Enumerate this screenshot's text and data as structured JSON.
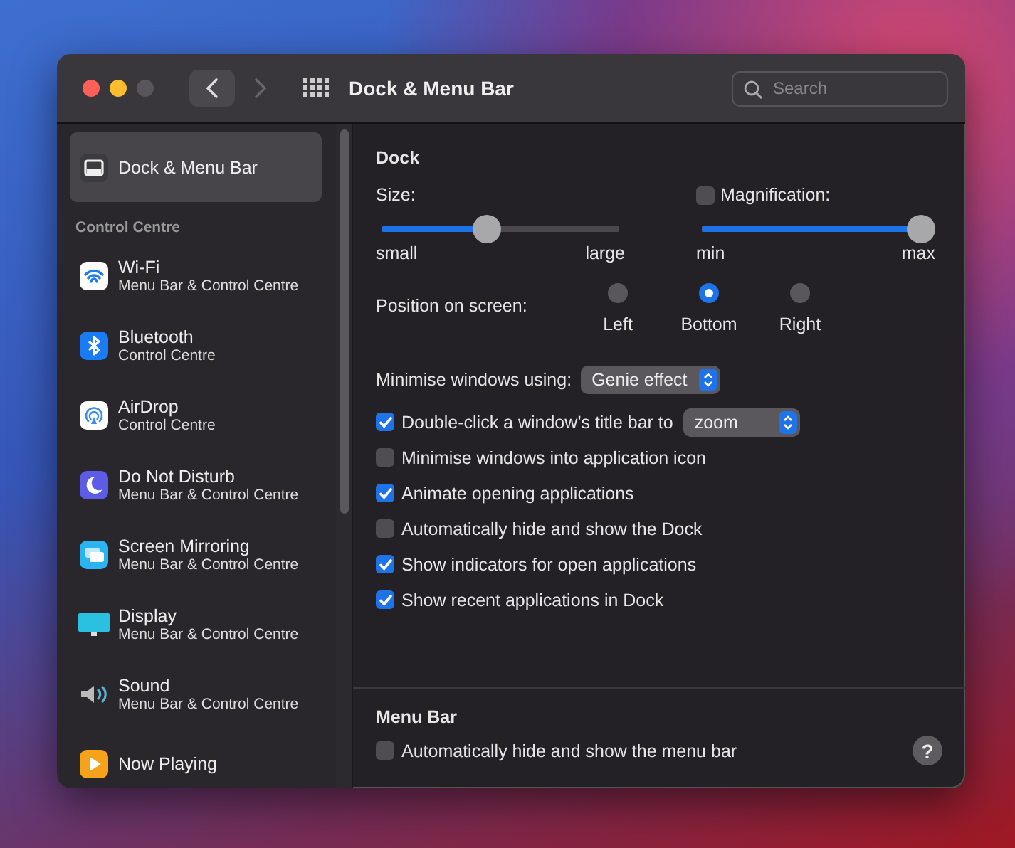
{
  "window": {
    "title": "Dock & Menu Bar"
  },
  "toolbar": {
    "search": {
      "placeholder": "Search"
    }
  },
  "sidebar": {
    "pinned": [
      {
        "label": "Dock & Menu Bar",
        "kind": "dock",
        "selected": true
      }
    ],
    "section": {
      "title": "Control Centre",
      "items": [
        {
          "label": "Wi-Fi",
          "subtitle": "Menu Bar & Control Centre",
          "kind": "wifi",
          "selected": false
        },
        {
          "label": "Bluetooth",
          "subtitle": "Control Centre",
          "kind": "bluetooth",
          "selected": false
        },
        {
          "label": "AirDrop",
          "subtitle": "Control Centre",
          "kind": "airdrop",
          "selected": false
        },
        {
          "label": "Do Not Disturb",
          "subtitle": "Menu Bar & Control Centre",
          "kind": "moon",
          "selected": false
        },
        {
          "label": "Screen Mirroring",
          "subtitle": "Menu Bar & Control Centre",
          "kind": "mirroring",
          "selected": false
        },
        {
          "label": "Display",
          "subtitle": "Menu Bar & Control Centre",
          "kind": "display",
          "selected": false
        },
        {
          "label": "Sound",
          "subtitle": "Menu Bar & Control Centre",
          "kind": "sound",
          "selected": false
        },
        {
          "label": "Now Playing",
          "kind": "play",
          "selected": false
        }
      ]
    }
  },
  "dock": {
    "title": "Dock",
    "sliders": [
      {
        "label": "Size:",
        "level": 0.44,
        "min_label": "small",
        "max_label": "large"
      },
      {
        "label": "Magnification:",
        "checked": false,
        "level": 1,
        "min_label": "min",
        "max_label": "max"
      }
    ],
    "position": {
      "label": "Position on screen:",
      "options": [
        {
          "label": "Left",
          "selected": false
        },
        {
          "label": "Bottom",
          "selected": true
        },
        {
          "label": "Right",
          "selected": false
        }
      ]
    },
    "minimise": {
      "label": "Minimise windows using:",
      "value": "Genie effect"
    },
    "checkboxes": [
      {
        "label": "Double-click a window’s title bar to",
        "checked": true,
        "select": "zoom"
      },
      {
        "label": "Minimise windows into application icon",
        "checked": false
      },
      {
        "label": "Animate opening applications",
        "checked": true
      },
      {
        "label": "Automatically hide and show the Dock",
        "checked": false
      },
      {
        "label": "Show indicators for open applications",
        "checked": true
      },
      {
        "label": "Show recent applications in Dock",
        "checked": true
      }
    ]
  },
  "menu_bar": {
    "title": "Menu Bar",
    "checkboxes": [
      {
        "label": "Automatically hide and show the menu bar",
        "checked": false
      }
    ],
    "help": "?"
  }
}
